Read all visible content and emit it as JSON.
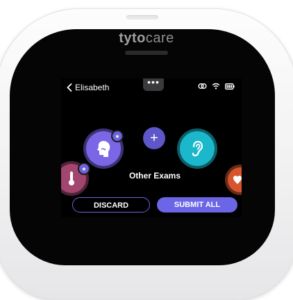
{
  "brand": {
    "part1": "tyto",
    "part2": "care"
  },
  "header": {
    "back_label": "Elisabeth",
    "menu_dots": "•••"
  },
  "main": {
    "other_exams_label": "Other Exams",
    "add_symbol": "+",
    "badge_symbol": "★"
  },
  "actions": {
    "discard_label": "DISCARD",
    "submit_label": "SUBMIT ALL"
  },
  "colors": {
    "accent": "#6b66e6",
    "throat_exam": "#7b67e6",
    "ear_exam": "#1bb7cb",
    "temperature_exam": "#a3466f",
    "heart_exam": "#d6552e"
  },
  "icons": [
    "back-chevron-icon",
    "link-icon",
    "wifi-icon",
    "battery-icon",
    "throat-icon",
    "ear-icon",
    "thermometer-icon",
    "heart-icon",
    "plus-icon",
    "star-icon"
  ]
}
